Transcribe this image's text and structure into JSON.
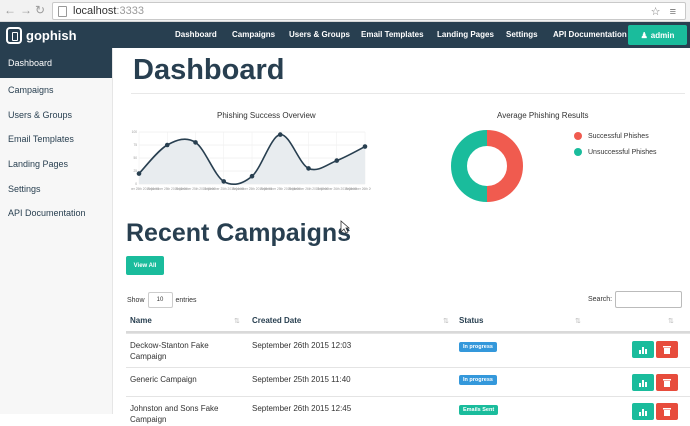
{
  "browser": {
    "url_host": "localhost",
    "url_port": ":3333",
    "tools": "☆ ≡"
  },
  "topbar": {
    "brand": "gophish",
    "nav": [
      "Dashboard",
      "Campaigns",
      "Users & Groups",
      "Email Templates",
      "Landing Pages",
      "Settings",
      "API Documentation"
    ],
    "user_button": "admin"
  },
  "sidebar": {
    "items": [
      "Dashboard",
      "Campaigns",
      "Users & Groups",
      "Email Templates",
      "Landing Pages",
      "Settings",
      "API Documentation"
    ],
    "active": "Dashboard"
  },
  "main": {
    "title": "Dashboard",
    "recent_title": "Recent Campaigns",
    "view_all": "View All",
    "show_label": "Show",
    "show_value": "10",
    "entries_label": "entries",
    "search_label": "Search:"
  },
  "colors": {
    "navy": "#283f50",
    "accent": "#1abc9c",
    "danger": "#e74c3c",
    "info": "#3498db"
  },
  "chart_data": [
    {
      "type": "line",
      "title": "Phishing Success Overview",
      "x": [
        "September 25th 2015 01:00",
        "September 25th 2015 02:00",
        "September 25th 2015 03:00",
        "September 25th 2015 04:00",
        "September 25th 2015 05:00",
        "September 25th 2015 06:00",
        "September 26th 2015 07:00",
        "September 26th 2015 08:00",
        "September 26th 2015 09:00"
      ],
      "values": [
        20,
        75,
        80,
        5,
        15,
        95,
        30,
        45,
        72
      ],
      "ylim": [
        0,
        100
      ],
      "grid": true
    },
    {
      "type": "pie",
      "title": "Average Phishing Results",
      "labels": [
        "Successful Phishes",
        "Unsuccessful Phishes"
      ],
      "values": [
        50,
        50
      ],
      "colors": [
        "#f05b4f",
        "#1abc9c"
      ],
      "legend": "right"
    }
  ],
  "table": {
    "columns": [
      "Name",
      "Created Date",
      "Status"
    ],
    "rows": [
      {
        "name": "Deckow-Stanton Fake Campaign",
        "date": "September 26th 2015 12:03",
        "status": "In progress",
        "status_color": "#3498db"
      },
      {
        "name": "Generic Campaign",
        "date": "September 25th 2015 11:40",
        "status": "In progress",
        "status_color": "#3498db"
      },
      {
        "name": "Johnston and Sons Fake Campaign",
        "date": "September 26th 2015 12:45",
        "status": "Emails Sent",
        "status_color": "#1abc9c"
      }
    ]
  }
}
